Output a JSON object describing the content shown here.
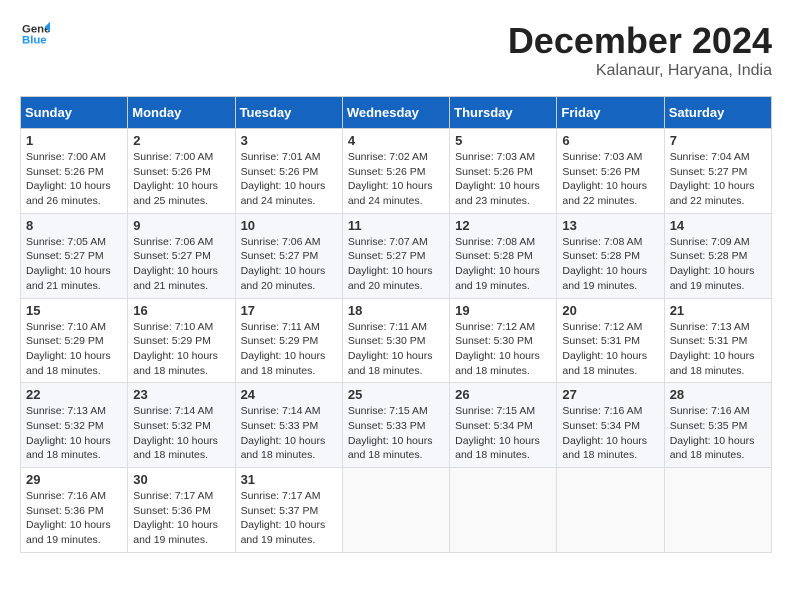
{
  "header": {
    "logo_line1": "General",
    "logo_line2": "Blue",
    "month": "December 2024",
    "location": "Kalanaur, Haryana, India"
  },
  "weekdays": [
    "Sunday",
    "Monday",
    "Tuesday",
    "Wednesday",
    "Thursday",
    "Friday",
    "Saturday"
  ],
  "weeks": [
    [
      {
        "day": "1",
        "sunrise": "Sunrise: 7:00 AM",
        "sunset": "Sunset: 5:26 PM",
        "daylight": "Daylight: 10 hours and 26 minutes."
      },
      {
        "day": "2",
        "sunrise": "Sunrise: 7:00 AM",
        "sunset": "Sunset: 5:26 PM",
        "daylight": "Daylight: 10 hours and 25 minutes."
      },
      {
        "day": "3",
        "sunrise": "Sunrise: 7:01 AM",
        "sunset": "Sunset: 5:26 PM",
        "daylight": "Daylight: 10 hours and 24 minutes."
      },
      {
        "day": "4",
        "sunrise": "Sunrise: 7:02 AM",
        "sunset": "Sunset: 5:26 PM",
        "daylight": "Daylight: 10 hours and 24 minutes."
      },
      {
        "day": "5",
        "sunrise": "Sunrise: 7:03 AM",
        "sunset": "Sunset: 5:26 PM",
        "daylight": "Daylight: 10 hours and 23 minutes."
      },
      {
        "day": "6",
        "sunrise": "Sunrise: 7:03 AM",
        "sunset": "Sunset: 5:26 PM",
        "daylight": "Daylight: 10 hours and 22 minutes."
      },
      {
        "day": "7",
        "sunrise": "Sunrise: 7:04 AM",
        "sunset": "Sunset: 5:27 PM",
        "daylight": "Daylight: 10 hours and 22 minutes."
      }
    ],
    [
      {
        "day": "8",
        "sunrise": "Sunrise: 7:05 AM",
        "sunset": "Sunset: 5:27 PM",
        "daylight": "Daylight: 10 hours and 21 minutes."
      },
      {
        "day": "9",
        "sunrise": "Sunrise: 7:06 AM",
        "sunset": "Sunset: 5:27 PM",
        "daylight": "Daylight: 10 hours and 21 minutes."
      },
      {
        "day": "10",
        "sunrise": "Sunrise: 7:06 AM",
        "sunset": "Sunset: 5:27 PM",
        "daylight": "Daylight: 10 hours and 20 minutes."
      },
      {
        "day": "11",
        "sunrise": "Sunrise: 7:07 AM",
        "sunset": "Sunset: 5:27 PM",
        "daylight": "Daylight: 10 hours and 20 minutes."
      },
      {
        "day": "12",
        "sunrise": "Sunrise: 7:08 AM",
        "sunset": "Sunset: 5:28 PM",
        "daylight": "Daylight: 10 hours and 19 minutes."
      },
      {
        "day": "13",
        "sunrise": "Sunrise: 7:08 AM",
        "sunset": "Sunset: 5:28 PM",
        "daylight": "Daylight: 10 hours and 19 minutes."
      },
      {
        "day": "14",
        "sunrise": "Sunrise: 7:09 AM",
        "sunset": "Sunset: 5:28 PM",
        "daylight": "Daylight: 10 hours and 19 minutes."
      }
    ],
    [
      {
        "day": "15",
        "sunrise": "Sunrise: 7:10 AM",
        "sunset": "Sunset: 5:29 PM",
        "daylight": "Daylight: 10 hours and 18 minutes."
      },
      {
        "day": "16",
        "sunrise": "Sunrise: 7:10 AM",
        "sunset": "Sunset: 5:29 PM",
        "daylight": "Daylight: 10 hours and 18 minutes."
      },
      {
        "day": "17",
        "sunrise": "Sunrise: 7:11 AM",
        "sunset": "Sunset: 5:29 PM",
        "daylight": "Daylight: 10 hours and 18 minutes."
      },
      {
        "day": "18",
        "sunrise": "Sunrise: 7:11 AM",
        "sunset": "Sunset: 5:30 PM",
        "daylight": "Daylight: 10 hours and 18 minutes."
      },
      {
        "day": "19",
        "sunrise": "Sunrise: 7:12 AM",
        "sunset": "Sunset: 5:30 PM",
        "daylight": "Daylight: 10 hours and 18 minutes."
      },
      {
        "day": "20",
        "sunrise": "Sunrise: 7:12 AM",
        "sunset": "Sunset: 5:31 PM",
        "daylight": "Daylight: 10 hours and 18 minutes."
      },
      {
        "day": "21",
        "sunrise": "Sunrise: 7:13 AM",
        "sunset": "Sunset: 5:31 PM",
        "daylight": "Daylight: 10 hours and 18 minutes."
      }
    ],
    [
      {
        "day": "22",
        "sunrise": "Sunrise: 7:13 AM",
        "sunset": "Sunset: 5:32 PM",
        "daylight": "Daylight: 10 hours and 18 minutes."
      },
      {
        "day": "23",
        "sunrise": "Sunrise: 7:14 AM",
        "sunset": "Sunset: 5:32 PM",
        "daylight": "Daylight: 10 hours and 18 minutes."
      },
      {
        "day": "24",
        "sunrise": "Sunrise: 7:14 AM",
        "sunset": "Sunset: 5:33 PM",
        "daylight": "Daylight: 10 hours and 18 minutes."
      },
      {
        "day": "25",
        "sunrise": "Sunrise: 7:15 AM",
        "sunset": "Sunset: 5:33 PM",
        "daylight": "Daylight: 10 hours and 18 minutes."
      },
      {
        "day": "26",
        "sunrise": "Sunrise: 7:15 AM",
        "sunset": "Sunset: 5:34 PM",
        "daylight": "Daylight: 10 hours and 18 minutes."
      },
      {
        "day": "27",
        "sunrise": "Sunrise: 7:16 AM",
        "sunset": "Sunset: 5:34 PM",
        "daylight": "Daylight: 10 hours and 18 minutes."
      },
      {
        "day": "28",
        "sunrise": "Sunrise: 7:16 AM",
        "sunset": "Sunset: 5:35 PM",
        "daylight": "Daylight: 10 hours and 18 minutes."
      }
    ],
    [
      {
        "day": "29",
        "sunrise": "Sunrise: 7:16 AM",
        "sunset": "Sunset: 5:36 PM",
        "daylight": "Daylight: 10 hours and 19 minutes."
      },
      {
        "day": "30",
        "sunrise": "Sunrise: 7:17 AM",
        "sunset": "Sunset: 5:36 PM",
        "daylight": "Daylight: 10 hours and 19 minutes."
      },
      {
        "day": "31",
        "sunrise": "Sunrise: 7:17 AM",
        "sunset": "Sunset: 5:37 PM",
        "daylight": "Daylight: 10 hours and 19 minutes."
      },
      null,
      null,
      null,
      null
    ]
  ]
}
